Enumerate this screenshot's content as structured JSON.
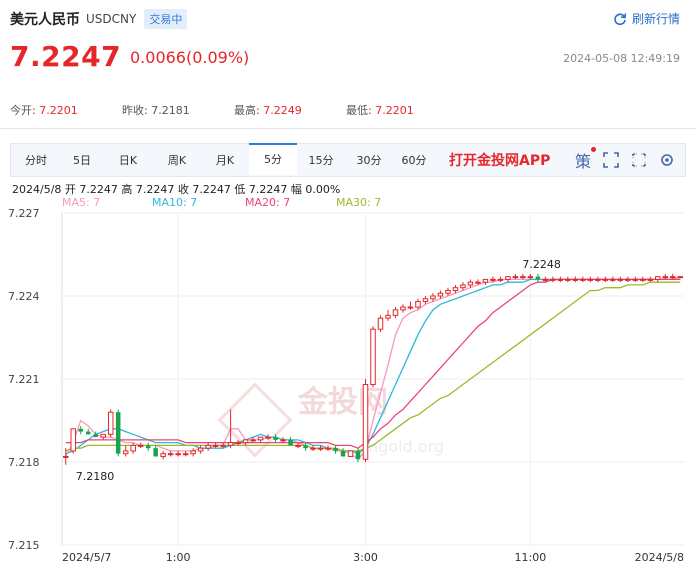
{
  "header": {
    "pair": "美元人民币",
    "code": "USDCNY",
    "badge": "交易中",
    "refresh": "刷新行情"
  },
  "quote": {
    "price": "7.2247",
    "change": "0.0066(0.09%)",
    "time": "2024-05-08 12:49:19"
  },
  "stats": [
    {
      "label": "今开:",
      "value": "7.2201"
    },
    {
      "label": "昨收:",
      "value": "7.2181"
    },
    {
      "label": "最高:",
      "value": "7.2249"
    },
    {
      "label": "最低:",
      "value": "7.2201"
    }
  ],
  "tabs": [
    "分时",
    "5日",
    "日K",
    "周K",
    "月K",
    "5分",
    "15分",
    "30分",
    "60分"
  ],
  "active_tab": "5分",
  "app_link": "打开金投网APP",
  "tool_icons": [
    "ce-icon",
    "expand-icon",
    "fullscreen-icon",
    "settings-icon"
  ],
  "tool_text": {
    "ce": "策"
  },
  "info_line": "2024/5/8  开 7.2247  高 7.2247  收 7.2247  低 7.2247  幅 0.00%",
  "ma_labels": [
    {
      "text": "MA5: 7",
      "color": "#f59ac0"
    },
    {
      "text": "MA10: 7",
      "color": "#2fb8d9"
    },
    {
      "text": "MA20: 7",
      "color": "#e8457a"
    },
    {
      "text": "MA30: 7",
      "color": "#9bbb2a"
    }
  ],
  "colors": {
    "up": "#e5262b",
    "down": "#19a34a",
    "accent": "#2f7bd9"
  },
  "watermark": {
    "text": "金投网",
    "sub": "ngold.org"
  },
  "chart_data": {
    "type": "candlestick",
    "y_ticks": [
      "7.227",
      "7.224",
      "7.221",
      "7.218",
      "7.215"
    ],
    "ylim": [
      7.215,
      7.227
    ],
    "x_ticks": [
      "2024/5/7",
      "1:00",
      "3:00",
      "11:00",
      "2024/5/8"
    ],
    "x_tick_index": [
      0,
      15,
      40,
      62,
      82
    ],
    "annotations": [
      {
        "text": "7.2248",
        "index": 62,
        "value": 7.2248
      },
      {
        "text": "7.2180",
        "index": 0,
        "value": 7.218
      }
    ],
    "candles": [
      [
        7.2182,
        7.2185,
        7.2179,
        7.2182
      ],
      [
        7.2184,
        7.2192,
        7.2183,
        7.2192
      ],
      [
        7.2192,
        7.2193,
        7.219,
        7.2191
      ],
      [
        7.2191,
        7.2192,
        7.219,
        7.219
      ],
      [
        7.219,
        7.2191,
        7.2189,
        7.2189
      ],
      [
        7.2189,
        7.219,
        7.2188,
        7.219
      ],
      [
        7.219,
        7.2199,
        7.2189,
        7.2198
      ],
      [
        7.2198,
        7.2199,
        7.2182,
        7.2183
      ],
      [
        7.2183,
        7.2186,
        7.2182,
        7.2184
      ],
      [
        7.2184,
        7.2187,
        7.2183,
        7.2186
      ],
      [
        7.2186,
        7.2187,
        7.2185,
        7.2186
      ],
      [
        7.2186,
        7.2187,
        7.2184,
        7.2185
      ],
      [
        7.2185,
        7.2186,
        7.2182,
        7.2182
      ],
      [
        7.2182,
        7.2184,
        7.2181,
        7.2183
      ],
      [
        7.2183,
        7.2184,
        7.2182,
        7.2183
      ],
      [
        7.2183,
        7.2184,
        7.2182,
        7.2183
      ],
      [
        7.2183,
        7.2184,
        7.2182,
        7.2183
      ],
      [
        7.2183,
        7.2185,
        7.2182,
        7.2184
      ],
      [
        7.2184,
        7.2186,
        7.2183,
        7.2185
      ],
      [
        7.2185,
        7.2187,
        7.2184,
        7.2186
      ],
      [
        7.2186,
        7.2187,
        7.2185,
        7.2186
      ],
      [
        7.2186,
        7.2187,
        7.2185,
        7.2186
      ],
      [
        7.2186,
        7.2199,
        7.2185,
        7.2187
      ],
      [
        7.2187,
        7.2188,
        7.2186,
        7.2187
      ],
      [
        7.2187,
        7.2188,
        7.2186,
        7.2188
      ],
      [
        7.2188,
        7.2189,
        7.2187,
        7.2188
      ],
      [
        7.2188,
        7.2189,
        7.2187,
        7.2189
      ],
      [
        7.2189,
        7.219,
        7.2188,
        7.2189
      ],
      [
        7.2189,
        7.219,
        7.2187,
        7.2188
      ],
      [
        7.2188,
        7.2189,
        7.2187,
        7.2188
      ],
      [
        7.2188,
        7.2189,
        7.2186,
        7.2186
      ],
      [
        7.2186,
        7.2187,
        7.2185,
        7.2186
      ],
      [
        7.2186,
        7.2187,
        7.2184,
        7.2185
      ],
      [
        7.2185,
        7.2186,
        7.2184,
        7.2185
      ],
      [
        7.2185,
        7.2186,
        7.2184,
        7.2185
      ],
      [
        7.2185,
        7.2186,
        7.2184,
        7.2185
      ],
      [
        7.2185,
        7.2186,
        7.2183,
        7.2184
      ],
      [
        7.2184,
        7.2185,
        7.2182,
        7.2182
      ],
      [
        7.2182,
        7.2184,
        7.2182,
        7.2184
      ],
      [
        7.2184,
        7.2185,
        7.218,
        7.2181
      ],
      [
        7.2181,
        7.221,
        7.218,
        7.2208
      ],
      [
        7.2208,
        7.2229,
        7.2207,
        7.2228
      ],
      [
        7.2228,
        7.2233,
        7.2227,
        7.2232
      ],
      [
        7.2232,
        7.2235,
        7.2231,
        7.2233
      ],
      [
        7.2233,
        7.2236,
        7.2232,
        7.2235
      ],
      [
        7.2235,
        7.2237,
        7.2234,
        7.2236
      ],
      [
        7.2236,
        7.2238,
        7.2235,
        7.2236
      ],
      [
        7.2236,
        7.2239,
        7.2235,
        7.2238
      ],
      [
        7.2238,
        7.224,
        7.2237,
        7.2239
      ],
      [
        7.2239,
        7.2241,
        7.2238,
        7.224
      ],
      [
        7.224,
        7.2242,
        7.2239,
        7.2241
      ],
      [
        7.2241,
        7.2243,
        7.224,
        7.2242
      ],
      [
        7.2242,
        7.2244,
        7.2241,
        7.2243
      ],
      [
        7.2243,
        7.2245,
        7.2242,
        7.2244
      ],
      [
        7.2244,
        7.2246,
        7.2243,
        7.2245
      ],
      [
        7.2245,
        7.2246,
        7.2244,
        7.2245
      ],
      [
        7.2245,
        7.2246,
        7.2244,
        7.2246
      ],
      [
        7.2246,
        7.2247,
        7.2245,
        7.2246
      ],
      [
        7.2246,
        7.2247,
        7.2245,
        7.2246
      ],
      [
        7.2246,
        7.2247,
        7.2245,
        7.2247
      ],
      [
        7.2247,
        7.2248,
        7.2246,
        7.2247
      ],
      [
        7.2247,
        7.2248,
        7.2246,
        7.2247
      ],
      [
        7.2247,
        7.2248,
        7.2246,
        7.2247
      ],
      [
        7.2247,
        7.2248,
        7.2245,
        7.2246
      ],
      [
        7.2246,
        7.2247,
        7.2245,
        7.2246
      ],
      [
        7.2246,
        7.2247,
        7.2245,
        7.2246
      ],
      [
        7.2246,
        7.2247,
        7.2245,
        7.2246
      ],
      [
        7.2246,
        7.2247,
        7.2245,
        7.2246
      ],
      [
        7.2246,
        7.2247,
        7.2245,
        7.2246
      ],
      [
        7.2246,
        7.2247,
        7.2245,
        7.2246
      ],
      [
        7.2246,
        7.2247,
        7.2245,
        7.2246
      ],
      [
        7.2246,
        7.2247,
        7.2245,
        7.2246
      ],
      [
        7.2246,
        7.2247,
        7.2245,
        7.2246
      ],
      [
        7.2246,
        7.2247,
        7.2245,
        7.2246
      ],
      [
        7.2246,
        7.2247,
        7.2245,
        7.2246
      ],
      [
        7.2246,
        7.2247,
        7.2245,
        7.2246
      ],
      [
        7.2246,
        7.2247,
        7.2245,
        7.2246
      ],
      [
        7.2246,
        7.2247,
        7.2245,
        7.2246
      ],
      [
        7.2246,
        7.2247,
        7.2245,
        7.2246
      ],
      [
        7.2246,
        7.2247,
        7.2245,
        7.2247
      ],
      [
        7.2247,
        7.2248,
        7.2246,
        7.2247
      ],
      [
        7.2247,
        7.2248,
        7.2246,
        7.2247
      ],
      [
        7.2247,
        7.2247,
        7.2247,
        7.2247
      ]
    ],
    "ma_series": [
      {
        "name": "MA5",
        "color": "#f59ac0",
        "values": [
          7.2182,
          7.2187,
          7.2195,
          7.2193,
          7.219,
          7.2189,
          7.2189,
          7.2188,
          7.2187,
          7.2187,
          7.2186,
          7.2186,
          7.2186,
          7.2185,
          7.2184,
          7.2184,
          7.2184,
          7.2184,
          7.2185,
          7.2185,
          7.2186,
          7.2186,
          7.2192,
          7.2192,
          7.2188,
          7.2188,
          7.2188,
          7.2189,
          7.2189,
          7.2188,
          7.2188,
          7.2187,
          7.2186,
          7.2185,
          7.2185,
          7.2185,
          7.2184,
          7.2184,
          7.2183,
          7.2181,
          7.2184,
          7.2195,
          7.2205,
          7.2215,
          7.2226,
          7.2232,
          7.2234,
          7.2235,
          7.2237,
          7.2238,
          7.2239,
          7.224,
          7.2241,
          7.2242,
          7.2243,
          7.2244,
          7.2245,
          7.2245,
          7.2246,
          7.2246,
          7.2246,
          7.2246,
          7.2246,
          7.2246,
          7.2246,
          7.2246,
          7.2246,
          7.2246,
          7.2246,
          7.2246,
          7.2246,
          7.2246,
          7.2246,
          7.2246,
          7.2246,
          7.2246,
          7.2246,
          7.2246,
          7.2246,
          7.2246,
          7.2246,
          7.2246,
          7.2247
        ]
      },
      {
        "name": "MA10",
        "color": "#2fb8d9",
        "values": [
          7.2183,
          7.2184,
          7.2186,
          7.2188,
          7.219,
          7.2191,
          7.2192,
          7.2192,
          7.2191,
          7.219,
          7.2189,
          7.2188,
          7.2187,
          7.2187,
          7.2187,
          7.2187,
          7.2186,
          7.2186,
          7.2185,
          7.2185,
          7.2185,
          7.2185,
          7.2186,
          7.2187,
          7.2188,
          7.2189,
          7.219,
          7.2189,
          7.2189,
          7.2188,
          7.2188,
          7.2188,
          7.2187,
          7.2186,
          7.2186,
          7.2185,
          7.2185,
          7.2184,
          7.2184,
          7.2183,
          7.2185,
          7.219,
          7.2196,
          7.2202,
          7.2208,
          7.2214,
          7.222,
          7.2226,
          7.2231,
          7.2235,
          7.2237,
          7.2238,
          7.2239,
          7.224,
          7.2241,
          7.2242,
          7.2243,
          7.2244,
          7.2244,
          7.2245,
          7.2245,
          7.2245,
          7.2246,
          7.2246,
          7.2246,
          7.2246,
          7.2246,
          7.2246,
          7.2246,
          7.2246,
          7.2246,
          7.2246,
          7.2246,
          7.2246,
          7.2246,
          7.2246,
          7.2246,
          7.2246,
          7.2246,
          7.2246,
          7.2246,
          7.2246,
          7.2246
        ]
      },
      {
        "name": "MA20",
        "color": "#e8457a",
        "values": [
          7.2187,
          7.2187,
          7.2187,
          7.2188,
          7.2188,
          7.2188,
          7.2188,
          7.2188,
          7.2188,
          7.2188,
          7.2188,
          7.2188,
          7.2188,
          7.2188,
          7.2188,
          7.2188,
          7.2187,
          7.2187,
          7.2187,
          7.2187,
          7.2187,
          7.2187,
          7.2187,
          7.2187,
          7.2187,
          7.2187,
          7.2187,
          7.2187,
          7.2187,
          7.2187,
          7.2187,
          7.2187,
          7.2187,
          7.2187,
          7.2187,
          7.2187,
          7.2186,
          7.2186,
          7.2186,
          7.2185,
          7.2187,
          7.2189,
          7.2192,
          7.2194,
          7.2197,
          7.2199,
          7.2202,
          7.2205,
          7.2208,
          7.2211,
          7.2214,
          7.2217,
          7.222,
          7.2223,
          7.2226,
          7.2229,
          7.2231,
          7.2234,
          7.2236,
          7.2238,
          7.224,
          7.2242,
          7.2244,
          7.2245,
          7.2245,
          7.2246,
          7.2246,
          7.2246,
          7.2246,
          7.2246,
          7.2246,
          7.2246,
          7.2246,
          7.2246,
          7.2246,
          7.2246,
          7.2246,
          7.2246,
          7.2246,
          7.2246,
          7.2246,
          7.2246,
          7.2246
        ]
      },
      {
        "name": "MA30",
        "color": "#9bbb2a",
        "values": [
          7.2184,
          7.2185,
          7.2185,
          7.2186,
          7.2186,
          7.2186,
          7.2186,
          7.2186,
          7.2186,
          7.2186,
          7.2186,
          7.2186,
          7.2186,
          7.2186,
          7.2186,
          7.2186,
          7.2186,
          7.2186,
          7.2186,
          7.2186,
          7.2186,
          7.2186,
          7.2186,
          7.2186,
          7.2186,
          7.2186,
          7.2186,
          7.2186,
          7.2186,
          7.2186,
          7.2186,
          7.2186,
          7.2186,
          7.2185,
          7.2185,
          7.2185,
          7.2185,
          7.2184,
          7.2184,
          7.2184,
          7.2185,
          7.2186,
          7.2188,
          7.219,
          7.2192,
          7.2194,
          7.2196,
          7.2197,
          7.2199,
          7.2201,
          7.2203,
          7.2204,
          7.2206,
          7.2208,
          7.221,
          7.2212,
          7.2214,
          7.2216,
          7.2218,
          7.222,
          7.2222,
          7.2224,
          7.2226,
          7.2228,
          7.223,
          7.2232,
          7.2234,
          7.2236,
          7.2238,
          7.224,
          7.2242,
          7.2242,
          7.2243,
          7.2243,
          7.2243,
          7.2244,
          7.2244,
          7.2244,
          7.2245,
          7.2245,
          7.2245,
          7.2245,
          7.2245
        ]
      }
    ]
  }
}
